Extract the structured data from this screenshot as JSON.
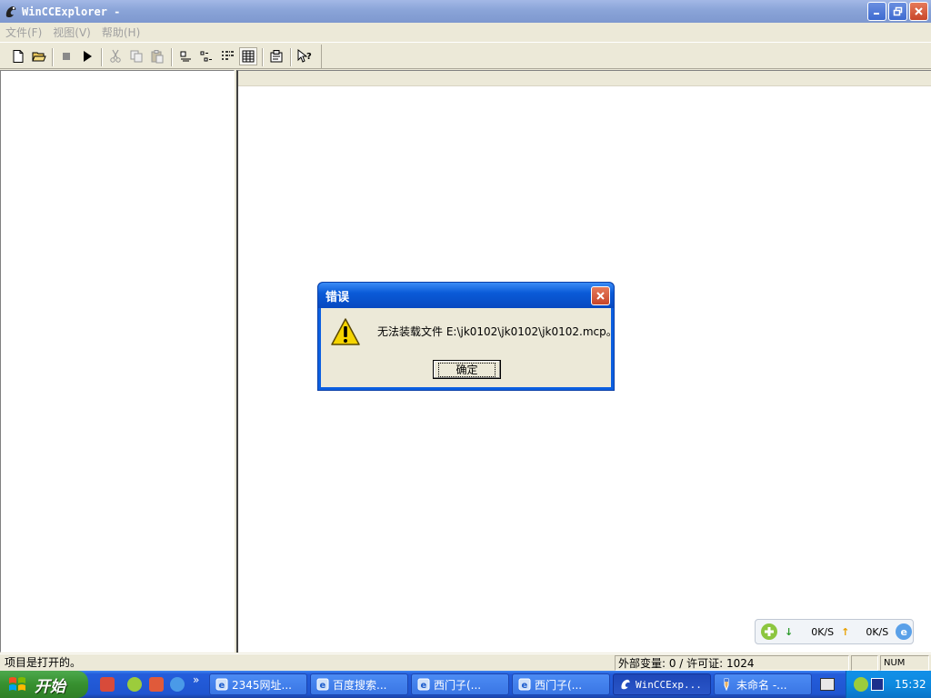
{
  "window": {
    "title": "WinCCExplorer -",
    "controls": [
      "minimize-icon",
      "restore-icon",
      "close-icon"
    ]
  },
  "menubar": {
    "items": [
      {
        "label": "文件(F)"
      },
      {
        "label": "视图(V)"
      },
      {
        "label": "帮助(H)"
      }
    ]
  },
  "toolbar": {
    "buttons": [
      "new-file-icon",
      "open-folder-icon",
      "stop-icon",
      "run-icon",
      "cut-icon",
      "copy-icon",
      "paste-icon",
      "large-icons-icon",
      "small-icons-icon",
      "list-view-icon",
      "details-view-icon",
      "properties-icon",
      "context-help-icon"
    ]
  },
  "dialog": {
    "title": "错误",
    "message": "无法装载文件 E:\\jk0102\\jk0102\\jk0102.mcp。",
    "ok_label": "确定",
    "icon": "warning-icon"
  },
  "speed_widget": {
    "down": "0K/S",
    "up": "0K/S"
  },
  "statusbar": {
    "text": "项目是打开的。",
    "tags_license": "外部变量: 0 / 许可证: 1024",
    "empty": "",
    "num": "NUM"
  },
  "taskbar": {
    "start_label": "开始",
    "tasks": [
      {
        "label": "2345网址..."
      },
      {
        "label": "百度搜索..."
      },
      {
        "label": "西门子(..."
      },
      {
        "label": "西门子(..."
      },
      {
        "label": "WinCCExp..."
      },
      {
        "label": "未命名 -..."
      }
    ],
    "quicklaunch_more": "»",
    "clock": "15:32"
  },
  "colors": {
    "title_bar": "#8aa4d8",
    "dialog_title": "#0a5bd8",
    "taskbar": "#245ddb",
    "start_button": "#37902f",
    "tray": "#0d8ae0"
  }
}
